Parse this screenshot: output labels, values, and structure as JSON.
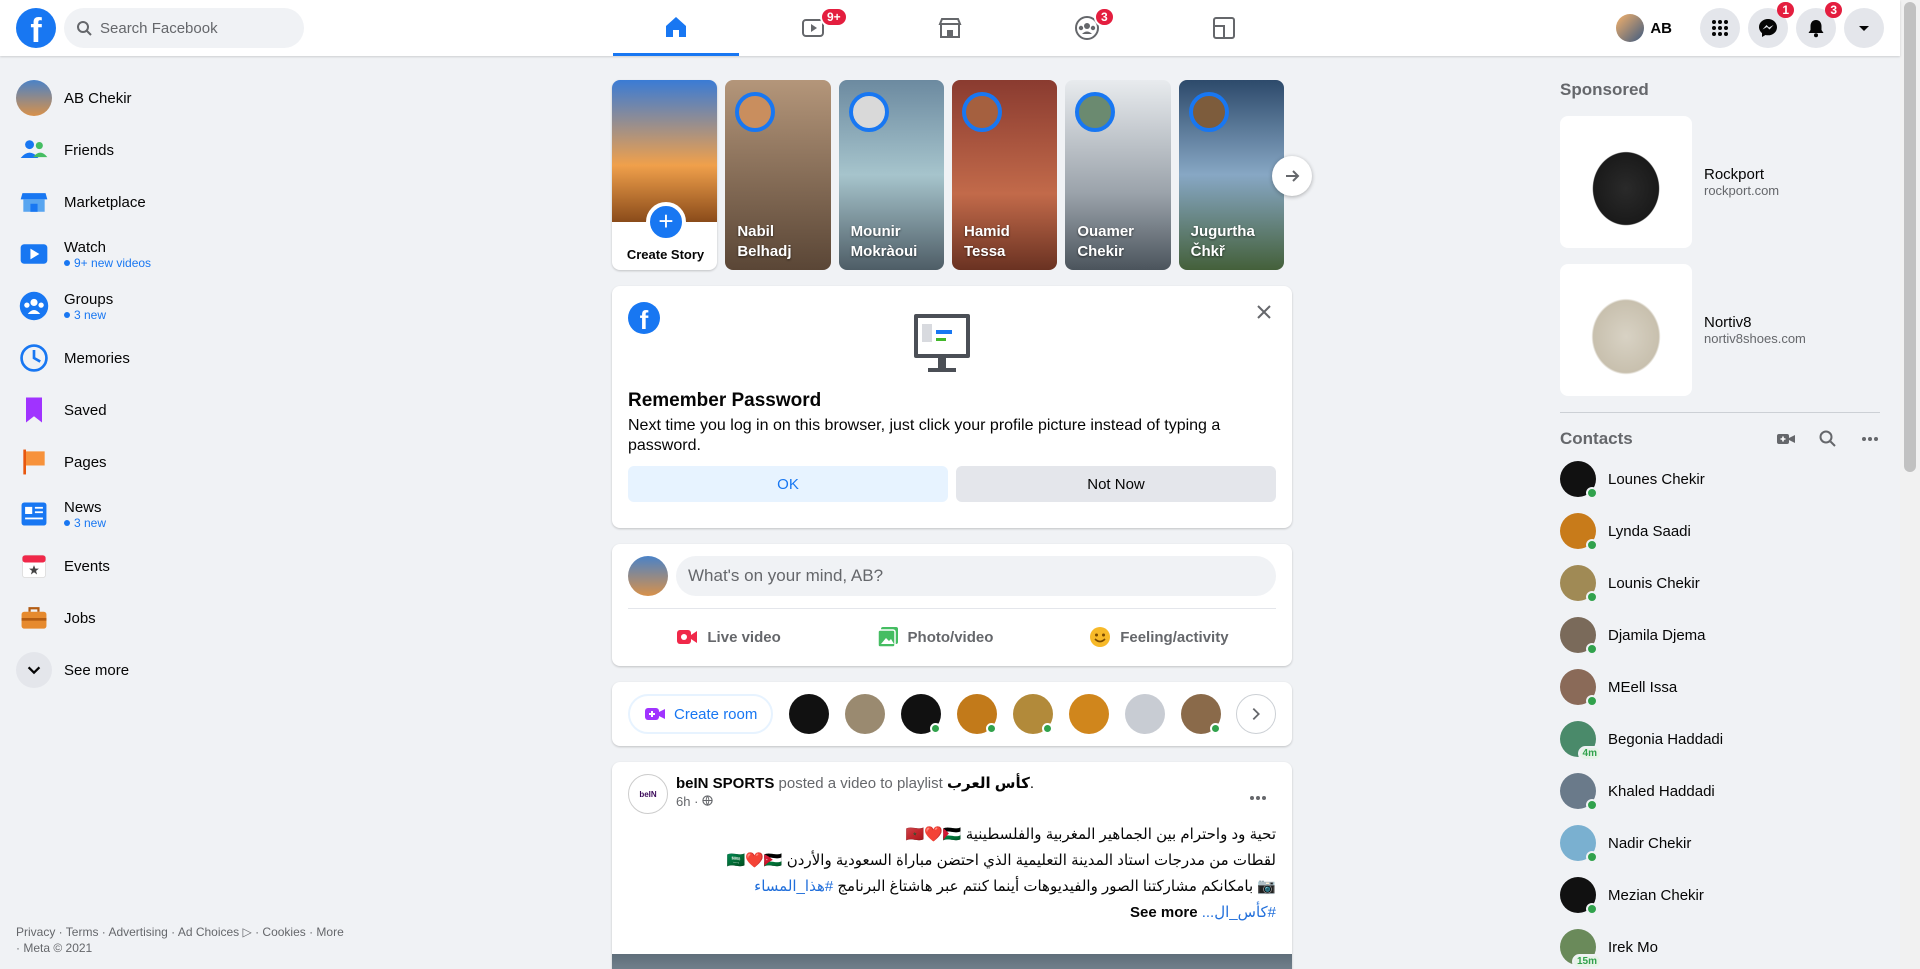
{
  "topbar": {
    "logo": "f",
    "search_placeholder": "Search Facebook",
    "tabs": [
      {
        "name": "home",
        "badge": ""
      },
      {
        "name": "watch",
        "badge": "9+"
      },
      {
        "name": "marketplace",
        "badge": ""
      },
      {
        "name": "groups",
        "badge": "3"
      },
      {
        "name": "gaming",
        "badge": ""
      }
    ],
    "profile_name": "AB",
    "messenger_badge": "1",
    "notifications_badge": "3"
  },
  "left_nav": {
    "items": [
      {
        "label": "AB Chekir",
        "sub": ""
      },
      {
        "label": "Friends",
        "sub": ""
      },
      {
        "label": "Marketplace",
        "sub": ""
      },
      {
        "label": "Watch",
        "sub": "9+ new videos"
      },
      {
        "label": "Groups",
        "sub": "3 new"
      },
      {
        "label": "Memories",
        "sub": ""
      },
      {
        "label": "Saved",
        "sub": ""
      },
      {
        "label": "Pages",
        "sub": ""
      },
      {
        "label": "News",
        "sub": "3 new"
      },
      {
        "label": "Events",
        "sub": ""
      },
      {
        "label": "Jobs",
        "sub": ""
      },
      {
        "label": "See more",
        "sub": ""
      }
    ],
    "footer": "Privacy · Terms · Advertising · Ad Choices ▷ · Cookies · More · Meta © 2021"
  },
  "stories": {
    "create_label": "Create Story",
    "items": [
      {
        "name": "Nabil Belhadj"
      },
      {
        "name": "Mounir Mokràoui"
      },
      {
        "name": "Hamid Tessa"
      },
      {
        "name": "Ouamer Chekir"
      },
      {
        "name": "Jugurtha Čhkř"
      }
    ]
  },
  "remember_password": {
    "title": "Remember Password",
    "text": "Next time you log in on this browser, just click your profile picture instead of typing a password.",
    "ok": "OK",
    "not_now": "Not Now"
  },
  "composer": {
    "placeholder": "What's on your mind, AB?",
    "live": "Live video",
    "photo": "Photo/video",
    "feeling": "Feeling/activity"
  },
  "rooms": {
    "create_room": "Create room"
  },
  "post": {
    "author": "beIN SPORTS",
    "action": " posted a video to playlist ",
    "playlist": "كأس العرب",
    "time": "6h · ",
    "line1": "تحية ود واحترام بين الجماهير المغربية والفلسطينية 🇲🇦❤️🇵🇸",
    "line2": "لقطات من مدرجات استاد المدينة التعليمية الذي احتضن مباراة السعودية والأردن 🇸🇦❤️🇯🇴",
    "line3": "📷 بامكانكم مشاركتنا الصور والفيديوهات أينما كنتم عبر هاشتاغ البرنامج ",
    "hashtag1": "#هذا_المساء",
    "hashtag2": "#كأس_ال...",
    "see_more": "See more "
  },
  "sponsored": {
    "title": "Sponsored",
    "ads": [
      {
        "name": "Rockport",
        "domain": "rockport.com"
      },
      {
        "name": "Nortiv8",
        "domain": "nortiv8shoes.com"
      }
    ]
  },
  "contacts": {
    "title": "Contacts",
    "items": [
      {
        "name": "Lounes Chekir",
        "status": ""
      },
      {
        "name": "Lynda Saadi",
        "status": ""
      },
      {
        "name": "Lounis Chekir",
        "status": ""
      },
      {
        "name": "Djamila Djema",
        "status": ""
      },
      {
        "name": "MEell Issa",
        "status": ""
      },
      {
        "name": "Begonia Haddadi",
        "status": "4m"
      },
      {
        "name": "Khaled Haddadi",
        "status": ""
      },
      {
        "name": "Nadir Chekir",
        "status": ""
      },
      {
        "name": "Mezian Chekir",
        "status": ""
      },
      {
        "name": "Irek Mo",
        "status": "15m"
      }
    ]
  },
  "colors": {
    "brand": "#1877f2",
    "badge": "#e41e3f",
    "online": "#31a24c",
    "page_bg": "#f0f2f5"
  }
}
